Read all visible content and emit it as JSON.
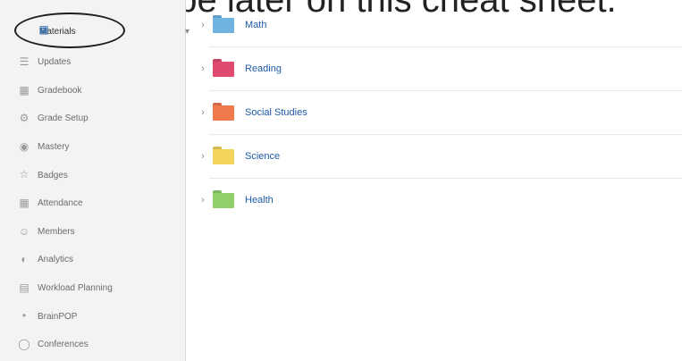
{
  "slide_caption": "Itself will be later on this cheat sheet.",
  "sidebar": {
    "top_item": {
      "label": "Materials",
      "icon": "materials-icon"
    },
    "items": [
      {
        "label": "Updates",
        "icon": "updates-icon"
      },
      {
        "label": "Gradebook",
        "icon": "gradebook-icon"
      },
      {
        "label": "Grade Setup",
        "icon": "grade-setup-icon"
      },
      {
        "label": "Mastery",
        "icon": "mastery-icon"
      },
      {
        "label": "Badges",
        "icon": "badges-icon"
      },
      {
        "label": "Attendance",
        "icon": "attendance-icon"
      },
      {
        "label": "Members",
        "icon": "members-icon"
      },
      {
        "label": "Analytics",
        "icon": "analytics-icon"
      },
      {
        "label": "Workload Planning",
        "icon": "workload-planning-icon"
      },
      {
        "label": "BrainPOP",
        "icon": "brainpop-icon"
      },
      {
        "label": "Conferences",
        "icon": "conferences-icon"
      }
    ]
  },
  "folders": [
    {
      "name": "Math",
      "color": "#6fb3e0"
    },
    {
      "name": "Reading",
      "color": "#e04a6e"
    },
    {
      "name": "Social Studies",
      "color": "#ef7a4c"
    },
    {
      "name": "Science",
      "color": "#f2d45a"
    },
    {
      "name": "Health",
      "color": "#8fd06a"
    }
  ]
}
